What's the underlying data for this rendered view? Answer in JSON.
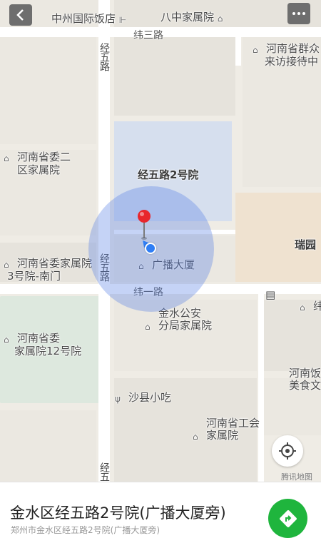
{
  "map": {
    "labels": {
      "zhongzhou_hotel": "中州国际饭店",
      "bazhong_homes": "八中家属院",
      "weisan_road": "纬三路",
      "jingwu_road_top": "经五路",
      "henan_qunzhong": "河南省群众",
      "laifang_center": "来访接待中",
      "henan_committee_2a": "河南省委二",
      "henan_committee_2b": "区家属院",
      "jingwu_2": "经五路2号院",
      "ruiyuan": "瑞园",
      "henan_committee_3a": "河南省委家属院",
      "henan_committee_3b": "3号院-南门",
      "jingwu_road_mid": "经五路",
      "broadcast_building": "广播大厦",
      "weiyi_road": "纬一路",
      "jinshui_police_a": "金水公安",
      "jinshui_police_b": "分局家属院",
      "wei_right": "纬",
      "henan_committee_12a": "河南省委",
      "henan_committee_12b": "家属院12号院",
      "henan_food_a": "河南饭",
      "henan_food_b": "美食文",
      "shaxian_snack": "沙县小吃",
      "henan_union_a": "河南省工会",
      "henan_union_b": "家属院",
      "jingwu_road_bottom": "经五"
    },
    "watermark": "腾讯地图",
    "accent_colors": {
      "location_dot": "#2f7ef5",
      "pin": "#e8262c",
      "navigate": "#1fb53d"
    }
  },
  "controls": {
    "back_icon": "chevron-left-icon",
    "more_icon": "more-dots-icon",
    "locate_icon": "crosshair-icon",
    "navigate_icon": "navigation-arrow-icon"
  },
  "panel": {
    "title": "金水区经五路2号院(广播大厦旁)",
    "subtitle": "郑州市金水区经五路2号院(广播大厦旁)"
  }
}
